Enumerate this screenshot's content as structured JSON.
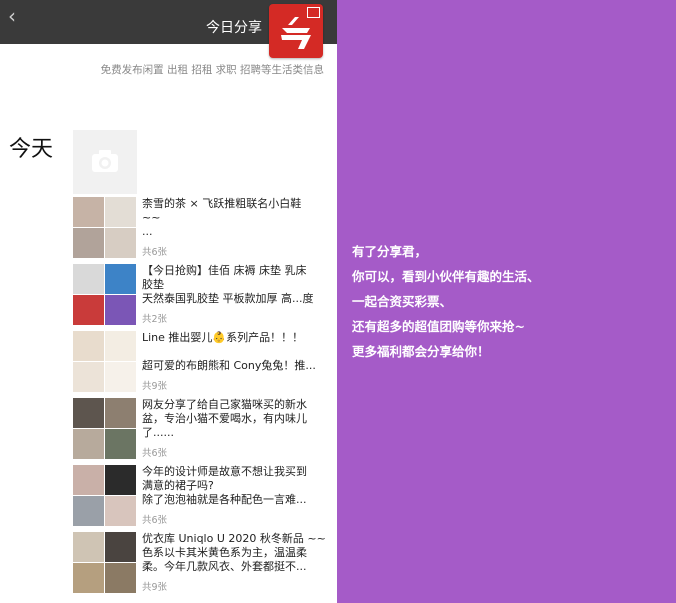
{
  "header": {
    "back_icon": "chevron-left-icon",
    "title": "今日分享",
    "logo_icon": "share-app-logo-icon",
    "logo_color": "#d42a25"
  },
  "subtitle": "免费发布闲置 出租 招租 求职 招聘等生活类信息",
  "section_day": "今天",
  "camera_icon": "camera-icon",
  "posts": [
    {
      "lines": [
        "柰雪的茶 × 飞跃推粗联名小白鞋",
        "~~",
        "..."
      ],
      "count": "共6张",
      "thumbs": [
        "#c6b3a6",
        "#e3ddd5",
        "#b1a39a",
        "#d7cdc3"
      ]
    },
    {
      "lines": [
        "【今日抢购】佳佰 床褥 床垫 乳床",
        "胶垫",
        "天然泰国乳胶垫 平板款加厚 高...度"
      ],
      "count": "共2张",
      "thumbs": [
        "#d9d9d9",
        "#3d83c7",
        "#c93b3a",
        "#7b56b6"
      ]
    },
    {
      "lines": [
        "Line 推出婴儿👶系列产品！！！",
        "",
        "超可爱的布朗熊和 Cony兔兔！推..."
      ],
      "count": "共9张",
      "thumbs": [
        "#e8dccd",
        "#f3ede3",
        "#ece3d8",
        "#f6f1ea"
      ]
    },
    {
      "lines": [
        "网友分享了给自己家猫咪买的新水",
        "盆，专治小猫不爱喝水，有内味儿",
        "了......"
      ],
      "count": "共6张",
      "thumbs": [
        "#5d554e",
        "#8d7f70",
        "#b7aa9c",
        "#6b7563"
      ]
    },
    {
      "lines": [
        "今年的设计师是故意不想让我买到",
        "满意的裙子吗?",
        "除了泡泡袖就是各种配色一言难..."
      ],
      "count": "共6张",
      "thumbs": [
        "#c9b0a8",
        "#2b2b2b",
        "#9aa0a8",
        "#d8c5bd"
      ]
    },
    {
      "lines": [
        "优衣库 Uniqlo U 2020 秋冬新品 ~~",
        "色系以卡其米黄色系为主，温温柔",
        "柔。今年几款风衣、外套都挺不..."
      ],
      "count": "共9张",
      "thumbs": [
        "#cfc4b4",
        "#4a4440",
        "#b59f7f",
        "#8b7a64"
      ]
    }
  ],
  "panel": {
    "background": "#a55bc8",
    "lines": [
      "有了分享君，",
      "你可以，看到小伙伴有趣的生活、",
      "一起合资买彩票、",
      "还有超多的超值团购等你来抢~",
      "更多福利都会分享给你！"
    ]
  }
}
